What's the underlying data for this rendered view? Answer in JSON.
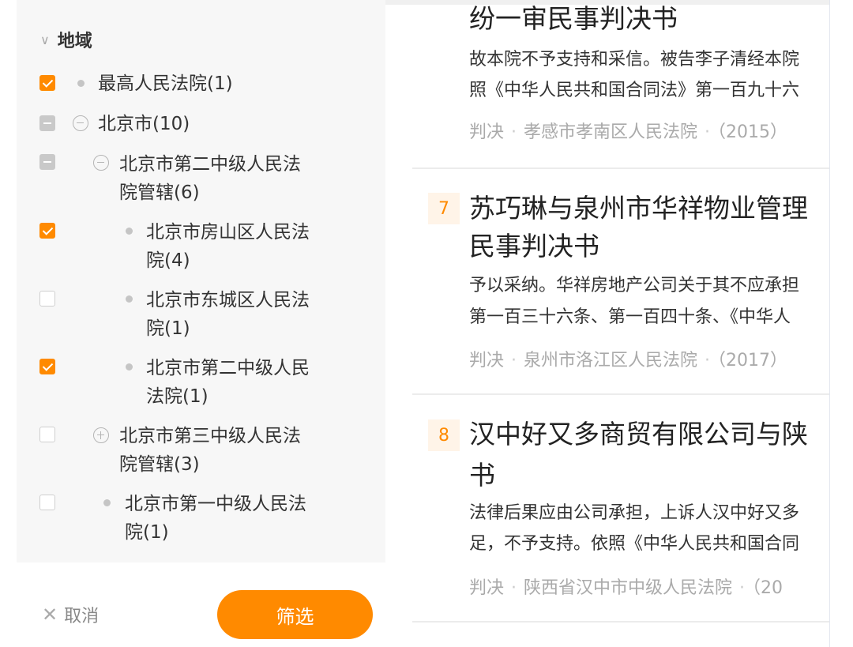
{
  "filter": {
    "section_title": "地域",
    "items": [
      {
        "label": "最高人民法院(1)",
        "state": "checked"
      },
      {
        "label": "北京市(10)",
        "state": "indeterminate"
      },
      {
        "label_line1": "北京市第二中级人民法",
        "label_line2": "院管辖(6)",
        "state": "indeterminate"
      },
      {
        "label_line1": "北京市房山区人民法",
        "label_line2": "院(4)",
        "state": "checked"
      },
      {
        "label_line1": "北京市东城区人民法",
        "label_line2": "院(1)",
        "state": "unchecked"
      },
      {
        "label_line1": "北京市第二中级人民",
        "label_line2": "法院(1)",
        "state": "checked"
      },
      {
        "label_line1": "北京市第三中级人民法",
        "label_line2": "院管辖(3)",
        "state": "unchecked"
      },
      {
        "label_line1": "北京市第一中级人民法",
        "label_line2": "院(1)",
        "state": "unchecked"
      }
    ],
    "cancel_label": "取消",
    "confirm_label": "筛选",
    "accent_color": "#ff8a00"
  },
  "results": [
    {
      "title_line1": "纷一审民事判决书",
      "snippet_line1": "故本院不予支持和采信。被告李子清经本院",
      "snippet_line2": "照《中华人民共和国合同法》第一百九十六",
      "type": "判决",
      "court": "孝感市孝南区人民法院",
      "year": "（2015）"
    },
    {
      "number": "7",
      "title_line1": "苏巧琳与泉州市华祥物业管理",
      "title_line2": "民事判决书",
      "snippet_line1": "予以采纳。华祥房地产公司关于其不应承担",
      "snippet_line2": "第一百三十六条、第一百四十条、《中华人",
      "type": "判决",
      "court": "泉州市洛江区人民法院",
      "year": "（2017）"
    },
    {
      "number": "8",
      "title_line1": "汉中好又多商贸有限公司与陕",
      "title_line2": "书",
      "snippet_line1": "法律后果应由公司承担，上诉人汉中好又多",
      "snippet_line2": "足，不予支持。依照《中华人民共和国合同",
      "type": "判决",
      "court": "陕西省汉中市中级人民法院",
      "year": "（20"
    }
  ]
}
